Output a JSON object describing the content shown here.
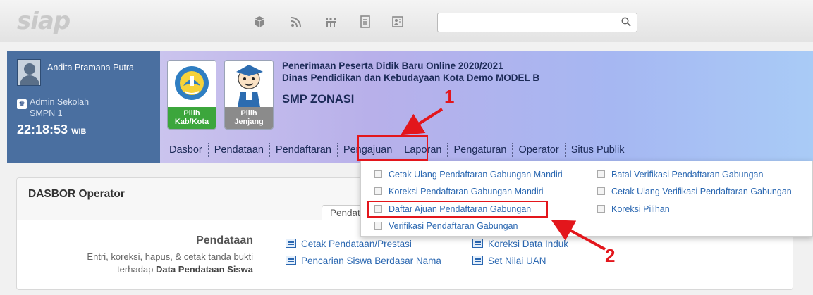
{
  "topbar": {
    "logo": "siap",
    "icons": [
      "package-icon",
      "rss-icon",
      "users-grid-icon",
      "document-icon",
      "id-card-icon"
    ],
    "search": {
      "value": "",
      "placeholder": ""
    }
  },
  "user": {
    "name": "Andita Pramana Putra",
    "role": "Admin Sekolah",
    "school": "SMPN 1",
    "time": "22:18:53",
    "timezone": "WIB"
  },
  "pickers": {
    "kab": "Pilih Kab/Kota",
    "jenjang": "Pilih Jenjang"
  },
  "header": {
    "line1": "Penerimaan Peserta Didik Baru Online 2020/2021",
    "line2": "Dinas Pendidikan dan Kebudayaan Kota Demo MODEL B",
    "school": "SMP ZONASI"
  },
  "nav": [
    "Dasbor",
    "Pendataan",
    "Pendaftaran",
    "Pengajuan",
    "Laporan",
    "Pengaturan",
    "Operator",
    "Situs Publik"
  ],
  "dropdown": {
    "col1": [
      "Cetak Ulang Pendaftaran Gabungan Mandiri",
      "Koreksi Pendaftaran Gabungan Mandiri",
      "Daftar Ajuan Pendaftaran Gabungan",
      "Verifikasi Pendaftaran Gabungan"
    ],
    "col2": [
      "Batal Verifikasi Pendaftaran Gabungan",
      "Cetak Ulang Verifikasi Pendaftaran Gabungan",
      "Koreksi Pilihan"
    ]
  },
  "annotations": {
    "n1": "1",
    "n2": "2"
  },
  "panel": {
    "title": "DASBOR Operator",
    "tab": "Pendataan",
    "section_title": "Pendataan",
    "desc_line1": "Entri, koreksi, hapus, & cetak tanda bukti",
    "desc_line2_prefix": "terhadap ",
    "desc_line2_bold": "Data Pendataan Siswa",
    "links": [
      "Cetak Pendataan/Prestasi",
      "Pencarian Siswa Berdasar Nama",
      "Koreksi Data Induk",
      "Set Nilai UAN"
    ]
  },
  "colors": {
    "accent_red": "#e3161c",
    "link_blue": "#2a67b1",
    "user_panel": "#4a6fa0"
  }
}
